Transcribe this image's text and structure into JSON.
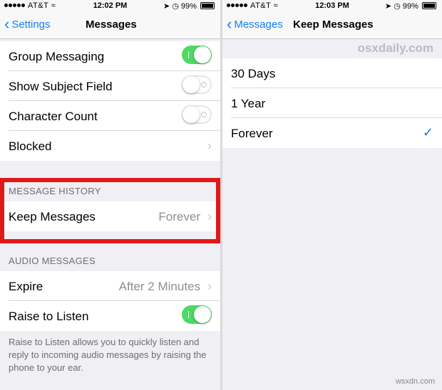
{
  "left": {
    "status": {
      "carrier": "AT&T",
      "time": "12:02 PM",
      "battery": "99%"
    },
    "nav": {
      "back_label": "Settings",
      "title": "Messages"
    },
    "group_messaging": {
      "label": "Group Messaging",
      "state": "on"
    },
    "show_subject": {
      "label": "Show Subject Field",
      "state": "off"
    },
    "character_count": {
      "label": "Character Count",
      "state": "off"
    },
    "blocked": {
      "label": "Blocked"
    },
    "history_header": "MESSAGE HISTORY",
    "keep_messages": {
      "label": "Keep Messages",
      "value": "Forever"
    },
    "audio_header": "AUDIO MESSAGES",
    "expire": {
      "label": "Expire",
      "value": "After 2 Minutes"
    },
    "raise_to_listen": {
      "label": "Raise to Listen",
      "state": "on"
    },
    "footer": "Raise to Listen allows you to quickly listen and reply to incoming audio messages by raising the phone to your ear."
  },
  "right": {
    "status": {
      "carrier": "AT&T",
      "time": "12:03 PM",
      "battery": "99%"
    },
    "nav": {
      "back_label": "Messages",
      "title": "Keep Messages"
    },
    "watermark": "osxdaily.com",
    "options": [
      {
        "label": "30 Days",
        "selected": false
      },
      {
        "label": "1 Year",
        "selected": false
      },
      {
        "label": "Forever",
        "selected": true
      }
    ]
  },
  "site_watermark": "wsxdn.com",
  "colors": {
    "accent": "#147efb",
    "switch_on": "#4cd964",
    "highlight": "#e01818"
  },
  "icons": [
    "chevron-left-icon",
    "chevron-right-icon",
    "checkmark-icon",
    "location-icon",
    "alarm-icon",
    "wifi-icon",
    "battery-icon"
  ]
}
